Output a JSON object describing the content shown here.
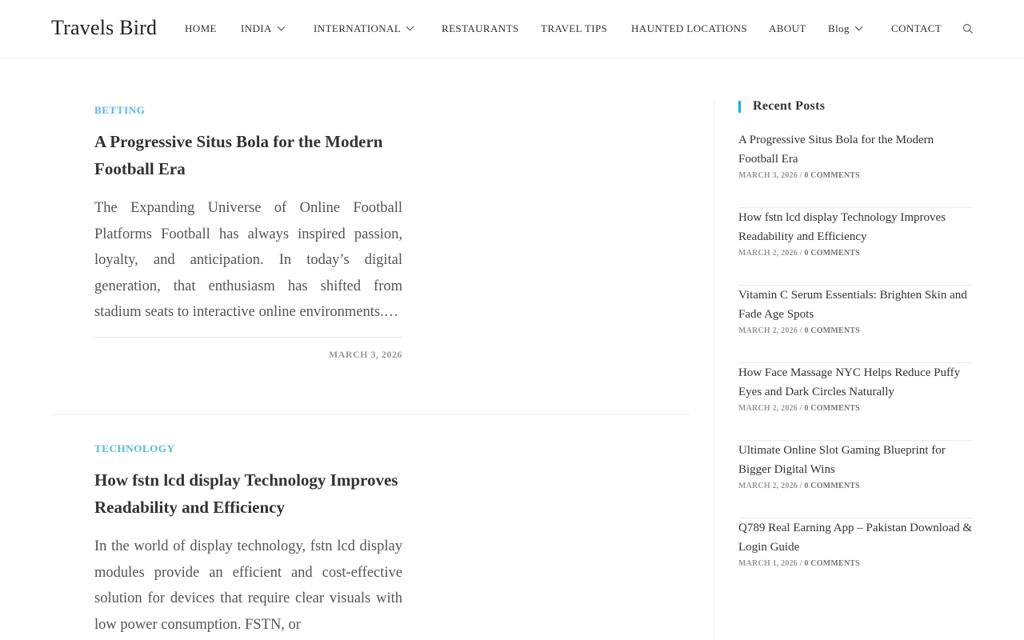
{
  "site": {
    "title": "Travels Bird"
  },
  "nav": {
    "items": [
      {
        "label": "HOME"
      },
      {
        "label": "INDIA",
        "dropdown": true
      },
      {
        "label": "INTERNATIONAL",
        "dropdown": true
      },
      {
        "label": "RESTAURANTS"
      },
      {
        "label": "TRAVEL TIPS"
      },
      {
        "label": "HAUNTED LOCATIONS"
      },
      {
        "label": "ABOUT"
      },
      {
        "label": "Blog",
        "dropdown": true
      },
      {
        "label": "CONTACT"
      }
    ],
    "search_icon": "search-icon"
  },
  "posts": [
    {
      "category": "BETTING",
      "title": "A Progressive Situs Bola for the Modern Football Era",
      "excerpt": "The Expanding Universe of Online Football Platforms Football has always inspired passion, loyalty, and anticipation. In today’s digital generation, that enthusiasm has shifted from stadium seats to interactive online environments.…",
      "date": "MARCH 3, 2026"
    },
    {
      "category": "TECHNOLOGY",
      "title": "How fstn lcd display Technology Improves Readability and Efficiency",
      "excerpt": "In the world of display technology, fstn lcd display modules provide an efficient and cost-effective solution for devices that require clear visuals with low power consumption. FSTN, or"
    }
  ],
  "sidebar": {
    "widget_title": "Recent Posts",
    "recent_posts": [
      {
        "title": "A Progressive Situs Bola for the Modern Football Era",
        "date": "MARCH 3, 2026",
        "comments": "0 COMMENTS"
      },
      {
        "title": "How fstn lcd display Technology Improves Readability and Efficiency",
        "date": "MARCH 2, 2026",
        "comments": "0 COMMENTS"
      },
      {
        "title": "Vitamin C Serum Essentials: Brighten Skin and Fade Age Spots",
        "date": "MARCH 2, 2026",
        "comments": "0 COMMENTS"
      },
      {
        "title": "How Face Massage NYC Helps Reduce Puffy Eyes and Dark Circles Naturally",
        "date": "MARCH 2, 2026",
        "comments": "0 COMMENTS"
      },
      {
        "title": "Ultimate Online Slot Gaming Blueprint for Bigger Digital Wins",
        "date": "MARCH 2, 2026",
        "comments": "0 COMMENTS"
      },
      {
        "title": "Q789  Real Earning App – Pakistan Download & Login Guide",
        "date": "MARCH 1, 2026",
        "comments": "0 COMMENTS"
      }
    ]
  },
  "colors": {
    "accent": "#13aff0",
    "category": "#55b9e4"
  }
}
